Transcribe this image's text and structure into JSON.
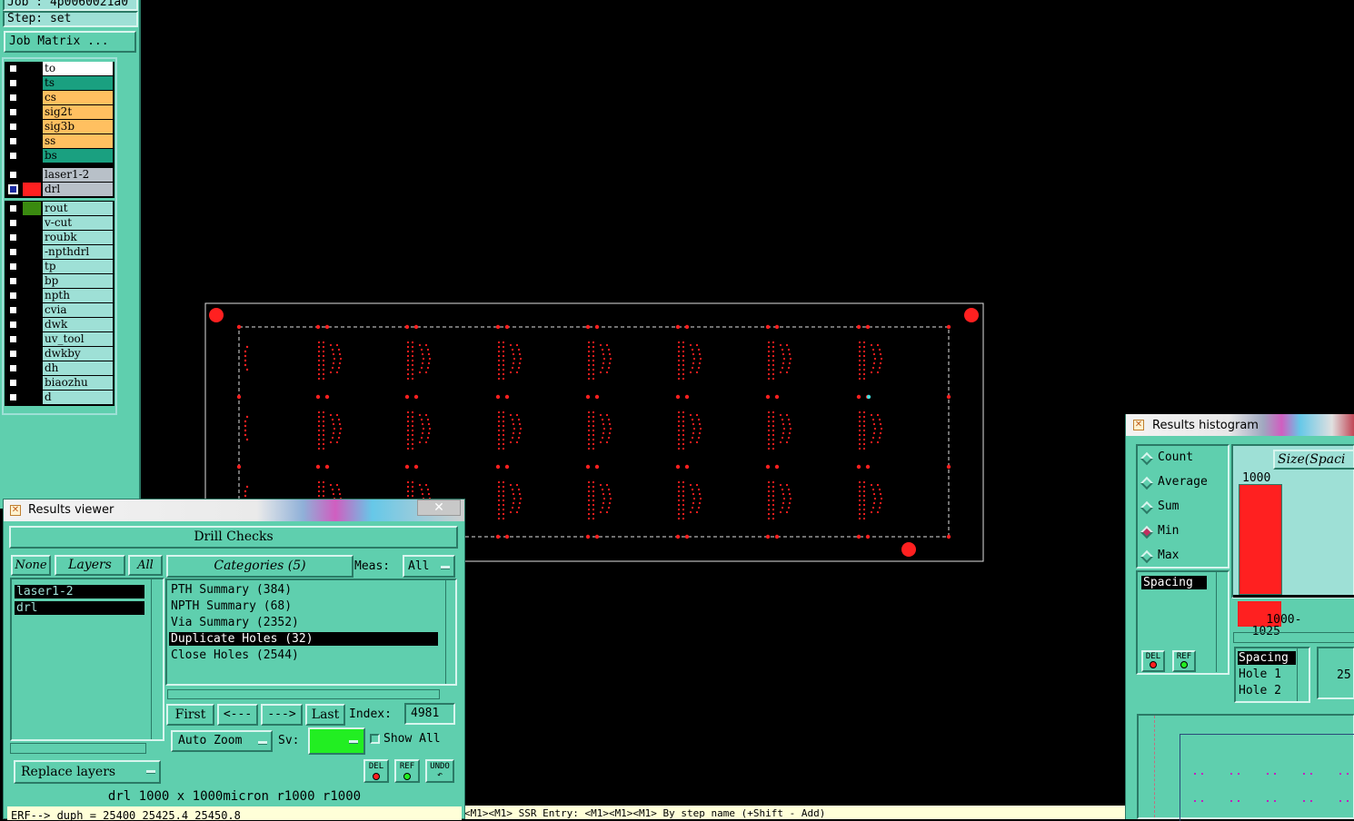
{
  "job": {
    "job_line": "Job : 4p0060021a0",
    "step_line": "Step: set",
    "matrix_button": "Job Matrix ..."
  },
  "layers_group1": [
    {
      "name": "to",
      "bg": "#ffffff"
    },
    {
      "name": "ts",
      "bg": "#1aa080"
    },
    {
      "name": "cs",
      "bg": "#ffc060"
    },
    {
      "name": "sig2t",
      "bg": "#ffc060"
    },
    {
      "name": "sig3b",
      "bg": "#ffc060"
    },
    {
      "name": "ss",
      "bg": "#ffc060"
    },
    {
      "name": "bs",
      "bg": "#1aa080"
    }
  ],
  "layers_group2": [
    {
      "name": "laser1-2",
      "bg": "#b8c0c8"
    },
    {
      "name": "drl",
      "bg": "#b8c0c8",
      "swatch": "#ff2020"
    }
  ],
  "layers_group3": [
    {
      "name": "rout",
      "swatch": "#3a8a10"
    },
    {
      "name": "v-cut"
    },
    {
      "name": "roubk"
    },
    {
      "name": "-npthdrl"
    },
    {
      "name": "tp"
    },
    {
      "name": "bp"
    },
    {
      "name": "npth"
    },
    {
      "name": "cvia"
    },
    {
      "name": "dwk"
    },
    {
      "name": "uv_tool"
    },
    {
      "name": "dwkby"
    },
    {
      "name": "dh"
    },
    {
      "name": "biaozhu"
    },
    {
      "name": "d"
    }
  ],
  "colors": {
    "teal": "#5fcfae",
    "light_teal": "#9ee0d6",
    "drill_red": "#ff2020",
    "highlight_cyan": "#40e0e0",
    "green_swatch": "#22ee22"
  },
  "results_viewer": {
    "title": "Results viewer",
    "close_icon": "close-icon",
    "header": "Drill Checks",
    "none_button": "None",
    "layers_button": "Layers",
    "all_button": "All",
    "layer_list": [
      "laser1-2",
      "drl"
    ],
    "categories_button": "Categories (5)",
    "meas_label": "Meas:",
    "meas_value": "All",
    "categories": [
      {
        "label": "PTH Summary (384)",
        "selected": false
      },
      {
        "label": "NPTH Summary (68)",
        "selected": false
      },
      {
        "label": "Via Summary (2352)",
        "selected": false
      },
      {
        "label": "Duplicate Holes (32)",
        "selected": true
      },
      {
        "label": "Close Holes (2544)",
        "selected": false
      }
    ],
    "nav": {
      "first": "First",
      "prev": "<---",
      "next": "--->",
      "last": "Last",
      "index_label": "Index:",
      "index_value": "4981"
    },
    "auto_zoom": "Auto Zoom",
    "sv_label": "Sv:",
    "show_all": "Show All",
    "replace_layers": "Replace layers",
    "del": "DEL",
    "ref": "REF",
    "undo": "UNDO",
    "status_line": "drl  1000 x 1000micron  r1000  r1000",
    "erf_line": "ERF--> duph = 25400 25425.4 25450.8"
  },
  "bottom_status": "<M1><M1>  SSR Entry: <M1><M1><M1>  By step name (+Shift - Add)",
  "histogram": {
    "title": "Results histogram",
    "options": [
      {
        "label": "Count",
        "selected": false
      },
      {
        "label": "Average",
        "selected": false
      },
      {
        "label": "Sum",
        "selected": false
      },
      {
        "label": "Min",
        "selected": true
      },
      {
        "label": "Max",
        "selected": false
      }
    ],
    "list_selected": "Spacing",
    "del": "DEL",
    "ref": "REF",
    "size_header": "Size(Spaci",
    "bar_value": "1000",
    "bar_range": "1000-\n  1025",
    "detail": [
      "Spacing",
      "Hole 1",
      "Hole 2"
    ],
    "value_25": "25"
  }
}
